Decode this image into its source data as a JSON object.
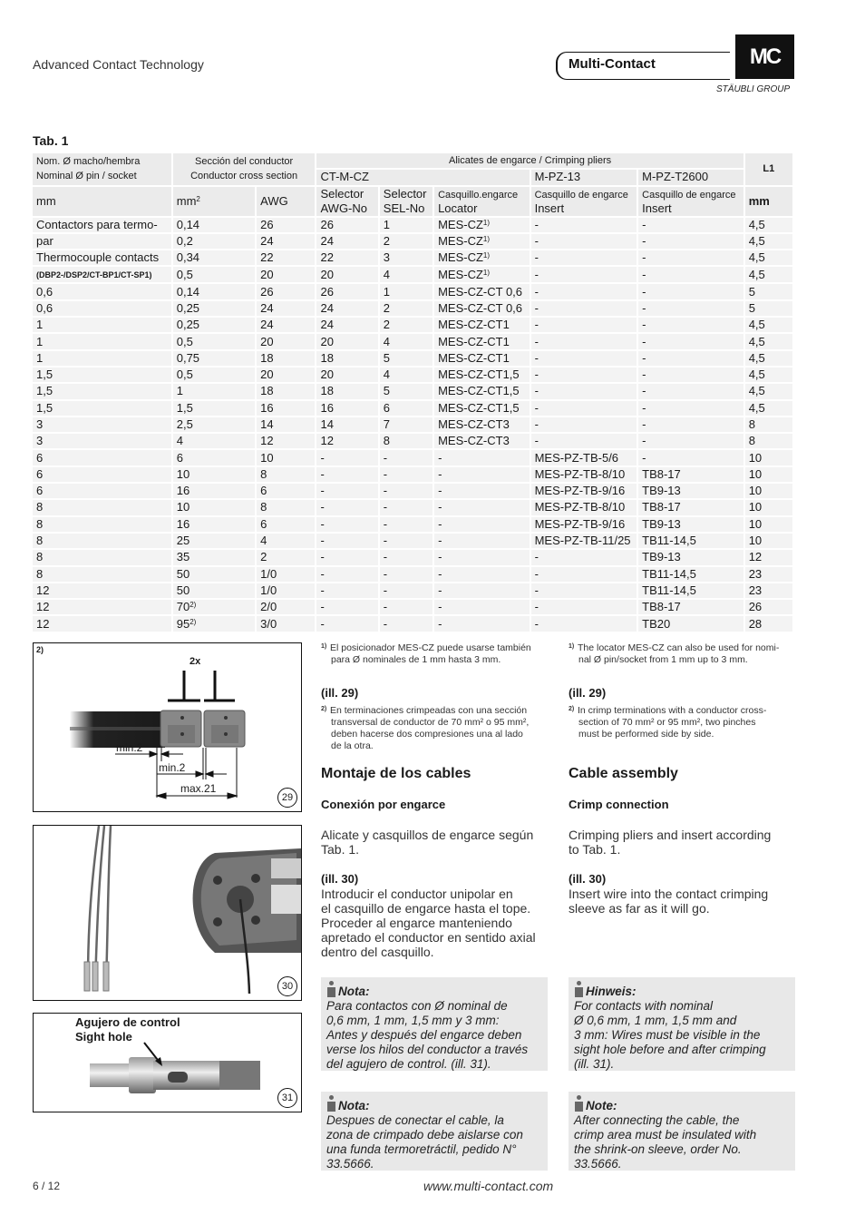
{
  "header": {
    "tagline": "Advanced Contact Technology",
    "brand": "Multi-Contact",
    "logo_mark": "MC",
    "group": "STÄUBLI GROUP"
  },
  "table": {
    "title": "Tab. 1",
    "head": {
      "nominal": [
        "Nom. Ø macho/hembra",
        "Nominal Ø pin / socket"
      ],
      "section": [
        "Sección del conductor",
        "Conductor cross section"
      ],
      "pliers": "Alicates de engarce / Crimping pliers",
      "l1": "L1",
      "tool1": "CT-M-CZ",
      "tool2": "M-PZ-13",
      "tool3": "M-PZ-T2600",
      "mm": "mm",
      "mm2": "mm",
      "awg": "AWG",
      "sel1": [
        "Selector",
        "AWG-No"
      ],
      "sel2": [
        "Selector",
        "SEL-No"
      ],
      "loc": [
        "Casquillo.engarce",
        "Locator"
      ],
      "ins2": [
        "Casquillo de engarce",
        "Insert"
      ],
      "ins3": [
        "Casquillo de engarce",
        "Insert"
      ],
      "l1mm": "mm"
    },
    "thermo_label": [
      "Contactors para termo-",
      "par",
      "Thermocouple contacts",
      "(DBP2-/DSP2/CT-BP1/CT-SP1)"
    ],
    "rows": [
      {
        "nom": "",
        "mm2": "0,14",
        "awg": "26",
        "awgno": "26",
        "sel": "1",
        "loc": "MES-CZ",
        "locsup": "1)",
        "pz13": "-",
        "t2600": "-",
        "l1": "4,5"
      },
      {
        "nom": "",
        "mm2": "0,2",
        "awg": "24",
        "awgno": "24",
        "sel": "2",
        "loc": "MES-CZ",
        "locsup": "1)",
        "pz13": "-",
        "t2600": "-",
        "l1": "4,5"
      },
      {
        "nom": "",
        "mm2": "0,34",
        "awg": "22",
        "awgno": "22",
        "sel": "3",
        "loc": "MES-CZ",
        "locsup": "1)",
        "pz13": "-",
        "t2600": "-",
        "l1": "4,5"
      },
      {
        "nom": "",
        "mm2": "0,5",
        "awg": "20",
        "awgno": "20",
        "sel": "4",
        "loc": "MES-CZ",
        "locsup": "1)",
        "pz13": "-",
        "t2600": "-",
        "l1": "4,5"
      },
      {
        "nom": "0,6",
        "mm2": "0,14",
        "awg": "26",
        "awgno": "26",
        "sel": "1",
        "loc": "MES-CZ-CT 0,6",
        "pz13": "-",
        "t2600": "-",
        "l1": "5"
      },
      {
        "nom": "0,6",
        "mm2": "0,25",
        "awg": "24",
        "awgno": "24",
        "sel": "2",
        "loc": "MES-CZ-CT 0,6",
        "pz13": "-",
        "t2600": "-",
        "l1": "5"
      },
      {
        "nom": "1",
        "mm2": "0,25",
        "awg": "24",
        "awgno": "24",
        "sel": "2",
        "loc": "MES-CZ-CT1",
        "pz13": "-",
        "t2600": "-",
        "l1": "4,5"
      },
      {
        "nom": "1",
        "mm2": "0,5",
        "awg": "20",
        "awgno": "20",
        "sel": "4",
        "loc": "MES-CZ-CT1",
        "pz13": "-",
        "t2600": "-",
        "l1": "4,5"
      },
      {
        "nom": "1",
        "mm2": "0,75",
        "awg": "18",
        "awgno": "18",
        "sel": "5",
        "loc": "MES-CZ-CT1",
        "pz13": "-",
        "t2600": "-",
        "l1": "4,5"
      },
      {
        "nom": "1,5",
        "mm2": "0,5",
        "awg": "20",
        "awgno": "20",
        "sel": "4",
        "loc": "MES-CZ-CT1,5",
        "pz13": "-",
        "t2600": "-",
        "l1": "4,5"
      },
      {
        "nom": "1,5",
        "mm2": "1",
        "awg": "18",
        "awgno": "18",
        "sel": "5",
        "loc": "MES-CZ-CT1,5",
        "pz13": "-",
        "t2600": "-",
        "l1": "4,5"
      },
      {
        "nom": "1,5",
        "mm2": "1,5",
        "awg": "16",
        "awgno": "16",
        "sel": "6",
        "loc": "MES-CZ-CT1,5",
        "pz13": "-",
        "t2600": "-",
        "l1": "4,5"
      },
      {
        "nom": "3",
        "mm2": "2,5",
        "awg": "14",
        "awgno": "14",
        "sel": "7",
        "loc": "MES-CZ-CT3",
        "pz13": "-",
        "t2600": "-",
        "l1": "8"
      },
      {
        "nom": "3",
        "mm2": "4",
        "awg": "12",
        "awgno": "12",
        "sel": "8",
        "loc": "MES-CZ-CT3",
        "pz13": "-",
        "t2600": "-",
        "l1": "8"
      },
      {
        "nom": "6",
        "mm2": "6",
        "awg": "10",
        "awgno": "-",
        "sel": "-",
        "loc": "-",
        "pz13": "MES-PZ-TB-5/6",
        "t2600": "-",
        "l1": "10"
      },
      {
        "nom": "6",
        "mm2": "10",
        "awg": "8",
        "awgno": "-",
        "sel": "-",
        "loc": "-",
        "pz13": "MES-PZ-TB-8/10",
        "t2600": "TB8-17",
        "l1": "10"
      },
      {
        "nom": "6",
        "mm2": "16",
        "awg": "6",
        "awgno": "-",
        "sel": "-",
        "loc": "-",
        "pz13": "MES-PZ-TB-9/16",
        "t2600": "TB9-13",
        "l1": "10"
      },
      {
        "nom": "8",
        "mm2": "10",
        "awg": "8",
        "awgno": "-",
        "sel": "-",
        "loc": "-",
        "pz13": "MES-PZ-TB-8/10",
        "t2600": "TB8-17",
        "l1": "10"
      },
      {
        "nom": "8",
        "mm2": "16",
        "awg": "6",
        "awgno": "-",
        "sel": "-",
        "loc": "-",
        "pz13": "MES-PZ-TB-9/16",
        "t2600": "TB9-13",
        "l1": "10"
      },
      {
        "nom": "8",
        "mm2": "25",
        "awg": "4",
        "awgno": "-",
        "sel": "-",
        "loc": "-",
        "pz13": "MES-PZ-TB-11/25",
        "t2600": "TB11-14,5",
        "l1": "10"
      },
      {
        "nom": "8",
        "mm2": "35",
        "awg": "2",
        "awgno": "-",
        "sel": "-",
        "loc": "-",
        "pz13": "-",
        "t2600": "TB9-13",
        "l1": "12"
      },
      {
        "nom": "8",
        "mm2": "50",
        "awg": "1/0",
        "awgno": "-",
        "sel": "-",
        "loc": "-",
        "pz13": "-",
        "t2600": "TB11-14,5",
        "l1": "23"
      },
      {
        "nom": "12",
        "mm2": "50",
        "awg": "1/0",
        "awgno": "-",
        "sel": "-",
        "loc": "-",
        "pz13": "-",
        "t2600": "TB11-14,5",
        "l1": "23"
      },
      {
        "nom": "12",
        "mm2": "70",
        "mm2sup": "2)",
        "awg": "2/0",
        "awgno": "-",
        "sel": "-",
        "loc": "-",
        "pz13": "-",
        "t2600": "TB8-17",
        "l1": "26"
      },
      {
        "nom": "12",
        "mm2": "95",
        "mm2sup": "2)",
        "awg": "3/0",
        "awgno": "-",
        "sel": "-",
        "loc": "-",
        "pz13": "-",
        "t2600": "TB20",
        "l1": "28"
      }
    ]
  },
  "figures": {
    "fig29": {
      "note_marker": "2)",
      "label_2x": "2x",
      "min2a": "min.2",
      "min2b": "min.2",
      "max21": "max.21",
      "number": "29"
    },
    "fig30": {
      "number": "30"
    },
    "fig31": {
      "label_es": "Agujero de control",
      "label_en": "Sight hole",
      "number": "31"
    }
  },
  "es": {
    "fn1_mark": "1)",
    "fn1": [
      "El posicionador MES-CZ puede usarse también",
      "para Ø nominales de 1 mm hasta 3 mm."
    ],
    "ill29": "(ill. 29)",
    "fn2_mark": "2)",
    "fn2": [
      "En terminaciones crimpeadas con una sección",
      "transversal de conductor de 70 mm² o 95 mm²,",
      "deben hacerse dos compresiones una al lado",
      "de la otra."
    ],
    "h2": "Montaje de los cables",
    "h3": "Conexión por engarce",
    "p1": [
      "Alicate y casquillos de engarce según",
      "Tab. 1."
    ],
    "ill30": "(ill. 30)",
    "p2": [
      "Introducir el conductor unipolar en",
      "el casquillo de engarce hasta el tope.",
      "Proceder al engarce manteniendo",
      "apretado el conductor en sentido axial",
      "dentro del casquillo."
    ],
    "note1_title": "Nota:",
    "note1": [
      "Para contactos con Ø nominal de",
      "0,6 mm, 1 mm, 1,5 mm y 3 mm:",
      "Antes y después del engarce deben",
      "verse los hilos del conductor a través",
      "del agujero de control. (ill. 31)."
    ],
    "note2_title": "Nota:",
    "note2": [
      "Despues de conectar el cable, la",
      "zona de crimpado debe aislarse con",
      "una funda termoretráctil, pedido N°",
      "33.5666."
    ]
  },
  "en": {
    "fn1_mark": "1)",
    "fn1": [
      "The locator MES-CZ can also be used for nomi-",
      "nal Ø pin/socket from 1 mm up to 3 mm."
    ],
    "ill29": "(ill. 29)",
    "fn2_mark": "2)",
    "fn2": [
      "In crimp terminations with a conductor cross-",
      "section of 70 mm² or 95 mm², two pinches",
      "must be performed side by side."
    ],
    "h2": "Cable assembly",
    "h3": "Crimp connection",
    "p1": [
      "Crimping pliers and insert according",
      "to Tab. 1."
    ],
    "ill30": "(ill. 30)",
    "p2": [
      "Insert wire into the contact crimping",
      "sleeve as far as it will go."
    ],
    "note1_title": "Hinweis:",
    "note1": [
      "For contacts with nominal",
      "Ø 0,6 mm, 1 mm, 1,5 mm and",
      "3 mm: Wires must be visible in the",
      "sight hole before and after crimping",
      "(ill. 31)."
    ],
    "note2_title": "Note:",
    "note2": [
      "After connecting the cable, the",
      "crimp area must be insulated with",
      "the shrink-on sleeve, order No.",
      "33.5666."
    ]
  },
  "footer": {
    "page": "6 / 12",
    "url": "www.multi-contact.com"
  }
}
